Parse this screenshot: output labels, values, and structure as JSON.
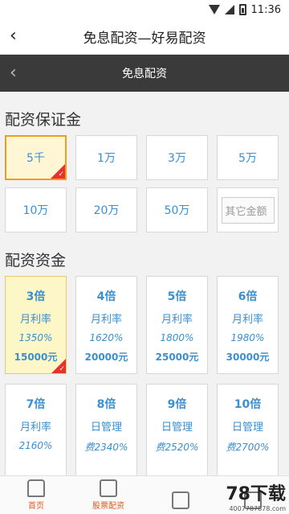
{
  "status": {
    "time": "11:36"
  },
  "titlebar": {
    "title": "免息配资—好易配资"
  },
  "subbar": {
    "title": "免息配资"
  },
  "margin_section": {
    "title": "配资保证金"
  },
  "amounts": [
    {
      "label": "5千",
      "selected": true
    },
    {
      "label": "1万",
      "selected": false
    },
    {
      "label": "3万",
      "selected": false
    },
    {
      "label": "5万",
      "selected": false
    },
    {
      "label": "10万",
      "selected": false
    },
    {
      "label": "20万",
      "selected": false
    },
    {
      "label": "50万",
      "selected": false
    },
    {
      "label": "其它金额",
      "selected": false,
      "other": true
    }
  ],
  "fund_section": {
    "title": "配资资金"
  },
  "multiples": [
    {
      "multiple": "3倍",
      "rate_label": "月利率",
      "rate": "1350%",
      "amount": "15000元",
      "selected": true
    },
    {
      "multiple": "4倍",
      "rate_label": "月利率",
      "rate": "1620%",
      "amount": "20000元",
      "selected": false
    },
    {
      "multiple": "5倍",
      "rate_label": "月利率",
      "rate": "1800%",
      "amount": "25000元",
      "selected": false
    },
    {
      "multiple": "6倍",
      "rate_label": "月利率",
      "rate": "1980%",
      "amount": "30000元",
      "selected": false
    },
    {
      "multiple": "7倍",
      "rate_label": "月利率",
      "rate": "2160%",
      "amount": "",
      "selected": false
    },
    {
      "multiple": "8倍",
      "rate_label": "日管理",
      "rate": "费2340%",
      "amount": "",
      "selected": false
    },
    {
      "multiple": "9倍",
      "rate_label": "日管理",
      "rate": "费2520%",
      "amount": "",
      "selected": false
    },
    {
      "multiple": "10倍",
      "rate_label": "日管理",
      "rate": "费2700%",
      "amount": "",
      "selected": false
    }
  ],
  "tabbar": {
    "tabs": [
      {
        "label": "首页",
        "icon": "home-icon"
      },
      {
        "label": "股票配资",
        "icon": "chart-icon"
      },
      {
        "label": "",
        "icon": "user-icon"
      },
      {
        "label": "",
        "icon": "person-icon"
      }
    ]
  },
  "watermark": {
    "big": "78下载",
    "small": "4007787878.com"
  }
}
